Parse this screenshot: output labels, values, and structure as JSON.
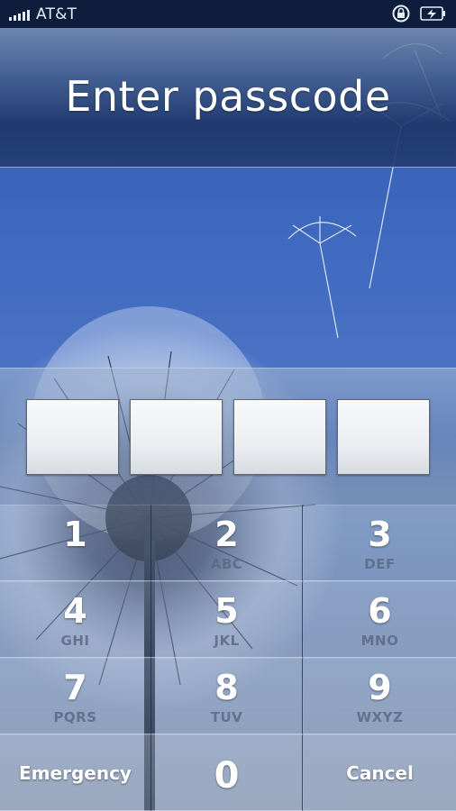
{
  "status_bar": {
    "carrier": "AT&T",
    "icons": [
      "signal-icon",
      "rotation-lock-icon",
      "battery-charging-icon"
    ]
  },
  "title": "Enter passcode",
  "passcode": {
    "digits_entered": 0,
    "slots": 4
  },
  "keypad": {
    "keys": [
      {
        "num": "1",
        "letters": ""
      },
      {
        "num": "2",
        "letters": "ABC"
      },
      {
        "num": "3",
        "letters": "DEF"
      },
      {
        "num": "4",
        "letters": "GHI"
      },
      {
        "num": "5",
        "letters": "JKL"
      },
      {
        "num": "6",
        "letters": "MNO"
      },
      {
        "num": "7",
        "letters": "PQRS"
      },
      {
        "num": "8",
        "letters": "TUV"
      },
      {
        "num": "9",
        "letters": "WXYZ"
      }
    ],
    "emergency_label": "Emergency",
    "zero": "0",
    "cancel_label": "Cancel"
  }
}
